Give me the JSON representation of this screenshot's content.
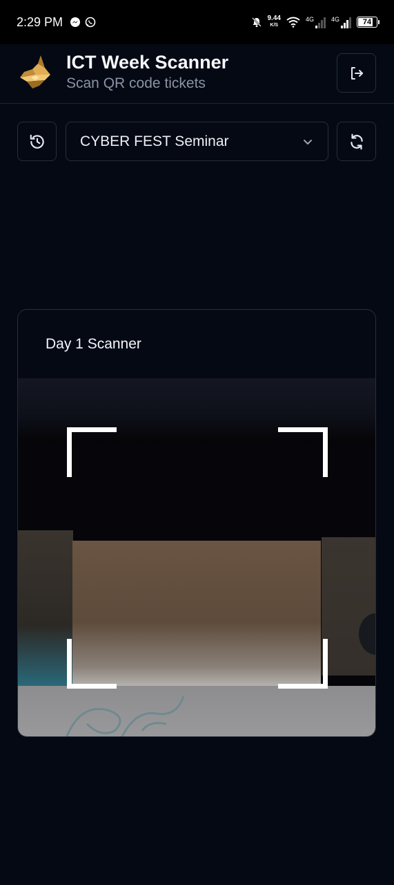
{
  "status_bar": {
    "time": "2:29 PM",
    "net_speed_value": "9.44",
    "net_speed_unit": "K/S",
    "signal_1_label": "4G",
    "signal_2_label": "4G",
    "battery_level": "74",
    "icons": [
      "messenger-icon",
      "whatsapp-icon",
      "bell-muted-icon",
      "wifi-icon",
      "signal-icon",
      "battery-icon"
    ]
  },
  "header": {
    "title": "ICT Week Scanner",
    "subtitle": "Scan QR code tickets",
    "logo_icon": "wolf-logo-icon",
    "logout_icon": "logout-icon"
  },
  "toolbar": {
    "history_icon": "history-icon",
    "selected_event": "CYBER FEST Seminar",
    "dropdown_icon": "chevron-down-icon",
    "refresh_icon": "refresh-icon"
  },
  "scanner": {
    "title": "Day 1 Scanner"
  },
  "colors": {
    "background": "#050914",
    "border": "#262e3d",
    "subtitle": "#8a93a6",
    "logo_gold": "#d9a548",
    "frame": "#ffffff"
  }
}
